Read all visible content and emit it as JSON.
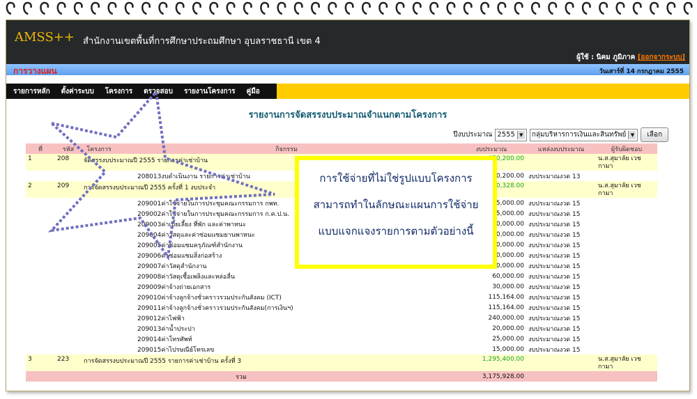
{
  "app": {
    "name": "AMSS++",
    "org": "สำนักงานเขตพื้นที่การศึกษาประถมศึกษา อุบลราชธานี เขต 4",
    "user": "ผู้ใช้ : นิคม ภูมิภาค",
    "logout": "[ออกจากระบบ]",
    "section": "การวางแผน",
    "date": "วันเสาร์ที่ 14 กรกฎาคม 2555"
  },
  "menu": [
    "รายการหลัก",
    "ตั้งค่าระบบ",
    "โครงการ",
    "ตรวจสอบ",
    "รายงานโครงการ",
    "คู่มือ"
  ],
  "report": {
    "title": "รายงานการจัดสรรงบประมาณจำแนกตามโครงการ",
    "year_label": "ปีงบประมาณ",
    "year": "2555",
    "group": "กลุ่มบริหารการเงินและสินทรัพย์",
    "select_btn": "เลือก"
  },
  "table": {
    "headers": [
      "ที่",
      "รหัส",
      "โครงการ",
      "กิจกรรม",
      "งบประมาณ",
      "แหล่งงบประมาณ",
      "ผู้รับผิดชอบ"
    ],
    "rows": [
      {
        "type": "main",
        "no": "1",
        "code": "208",
        "name": "จัดสรรงบประมาณปี 2555 รายการค่าเช่าบ้าน",
        "amount": "670,200.00",
        "resp": "น.ส.สุมาลัย เวชกามา"
      },
      {
        "type": "act",
        "activity": "208013งบดำเนินงาน รายการค่าเช่าบ้าน",
        "amount": "670,200.00",
        "source": "งบประมาณงวด 13"
      },
      {
        "type": "main",
        "no": "2",
        "code": "209",
        "name": "การจัดสรรงบประมาณปี 2555 ครั้งที่ 1 งบประจำ",
        "amount": "1,210,328.00",
        "resp": "น.ส.สุมาลัย เวชกามา"
      },
      {
        "type": "act",
        "activity": "209001ค่าใช้จ่ายในการประชุมคณะกรรมการ กพท.",
        "amount": "25,000.00",
        "source": "งบประมาณงวด 15"
      },
      {
        "type": "act",
        "activity": "209002ค่าใช้จ่ายในการประชุมคณะกรรมการ ก.ค.ป.น.",
        "amount": "15,000.00",
        "source": "งบประมาณงวด 15"
      },
      {
        "type": "act",
        "activity": "209003ค่าเบี้ยเลี้ยง ที่พัก และค่าพาหนะ",
        "amount": "150,000.00",
        "source": "งบประมาณงวด 15"
      },
      {
        "type": "act",
        "activity": "209004ค่าวัสดุและค่าซ่อมแซมยานพาหนะ",
        "amount": "50,000.00",
        "source": "งบประมาณงวด 15"
      },
      {
        "type": "act",
        "activity": "209005ค่าซ่อมแซมครุภัณฑ์สำนักงาน",
        "amount": "50,000.00",
        "source": "งบประมาณงวด 15"
      },
      {
        "type": "act",
        "activity": "209006ค่าซ่อมแซมสิ่งก่อสร้าง",
        "amount": "100,000.00",
        "source": "งบประมาณงวด 15"
      },
      {
        "type": "act",
        "activity": "209007ค่าวัสดุสำนักงาน",
        "amount": "200,000.00",
        "source": "งบประมาณงวด 15"
      },
      {
        "type": "act",
        "activity": "209008ค่าวัสดุเชื้อเพลิงและหล่อลื่น",
        "amount": "60,000.00",
        "source": "งบประมาณงวด 15"
      },
      {
        "type": "act",
        "activity": "209009ค่าจ้างถ่ายเอกสาร",
        "amount": "30,000.00",
        "source": "งบประมาณงวด 15"
      },
      {
        "type": "act",
        "activity": "209010ค่าจ้างลูกจ้างชั่วคราวรวมประกันสังคม (ICT)",
        "amount": "115,164.00",
        "source": "งบประมาณงวด 15"
      },
      {
        "type": "act",
        "activity": "209011ค่าจ้างลูกจ้างชั่วคราวรวมประกันสังคม(การเงินฯ)",
        "amount": "115,164.00",
        "source": "งบประมาณงวด 15"
      },
      {
        "type": "act",
        "activity": "209012ค่าไฟฟ้า",
        "amount": "240,000.00",
        "source": "งบประมาณงวด 15"
      },
      {
        "type": "act",
        "activity": "209013ค่าน้ำประปา",
        "amount": "20,000.00",
        "source": "งบประมาณงวด 15"
      },
      {
        "type": "act",
        "activity": "209014ค่าโทรศัพท์",
        "amount": "25,000.00",
        "source": "งบประมาณงวด 15"
      },
      {
        "type": "act",
        "activity": "209015ค่าไปรษณีย์โทรเลข",
        "amount": "15,000.00",
        "source": "งบประมาณงวด 15"
      },
      {
        "type": "main",
        "no": "3",
        "code": "223",
        "name": "การจัดสรรงบประมาณปี 2555 รายการค่าเช่าบ้าน ครั้งที่ 3",
        "amount": "1,295,400.00",
        "resp": "น.ส.สุมาลัย เวชกามา"
      }
    ],
    "total_label": "รวม",
    "total": "3,175,928.00"
  },
  "note": [
    "การใช้จ่ายที่ไม่ใช่รูปแบบโครงการ",
    "สามารถทำในลักษณะแผนการใช้จ่าย",
    "แบบแจกแจงรายการตามตัวอย่างนี้"
  ],
  "colors": {
    "banner": "#25292a",
    "accent": "#f2b705",
    "menu_bar": "#ffcc00",
    "header_row": "#f7c1c1",
    "project_row": "#ffffcc",
    "note_border": "#ffff00"
  }
}
